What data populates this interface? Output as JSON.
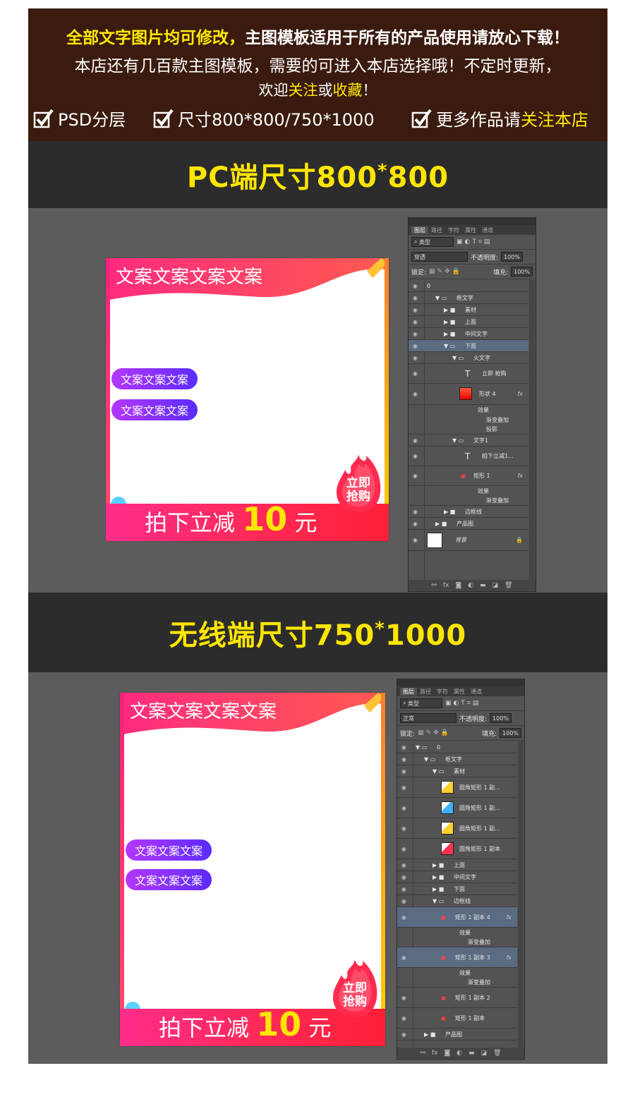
{
  "header": {
    "line1_bold": "全部文字图片均可修改，",
    "line1_rest": "主图模板适用于所有的产品使用请放心下载！",
    "line2": "本店还有几百款主图模板，需要的可进入本店选择哦！不定时更新，",
    "line3_a": "欢迎",
    "line3_b": "关注",
    "line3_c": "或",
    "line3_d": "收藏",
    "line3_e": "！",
    "check1": "PSD分层",
    "check2": "尺寸800*800/750*1000",
    "check3_a": "更多作品请",
    "check3_b": "关注本店"
  },
  "pc": {
    "banner_a": "PC端尺寸800",
    "banner_star": "*",
    "banner_b": "800",
    "template": {
      "title": "文案文案文案文案",
      "pill1": "文案文案文案",
      "pill2": "文案文案文案",
      "badge_l1": "立即",
      "badge_l2": "抢购",
      "bottom_pre": "拍下立减 ",
      "bottom_num": "10",
      "bottom_post": " 元"
    },
    "panel": {
      "tabs": [
        "图层",
        "路径",
        "字符",
        "属性",
        "通道"
      ],
      "filter": "类型",
      "blend": "穿透",
      "opacity_label": "不透明度:",
      "opacity": "100%",
      "lock_label": "锁定:",
      "fill_label": "填充:",
      "fill": "100%",
      "layers": [
        "0",
        "框文字",
        "素材",
        "上面",
        "中间文字",
        "下面",
        "火文字",
        "立即 抢购",
        "形状 4",
        "效果",
        "渐变叠加",
        "投影",
        "文字1",
        "拍下立减1...",
        "矩形 1",
        "效果",
        "渐变叠加",
        "边框线",
        "产品图",
        "背景"
      ]
    }
  },
  "mobile": {
    "banner_a": "无线端尺寸750",
    "banner_star": "*",
    "banner_b": "1000",
    "template": {
      "title": "文案文案文案文案",
      "pill1": "文案文案文案",
      "pill2": "文案文案文案",
      "badge_l1": "立即",
      "badge_l2": "抢购",
      "bottom_pre": "拍下立减 ",
      "bottom_num": "10",
      "bottom_post": " 元"
    },
    "panel": {
      "tabs": [
        "图层",
        "路径",
        "字符",
        "属性",
        "通道"
      ],
      "filter": "类型",
      "blend": "正常",
      "opacity_label": "不透明度:",
      "opacity": "100%",
      "lock_label": "锁定:",
      "fill_label": "填充:",
      "fill": "100%",
      "layers": [
        "0",
        "框文字",
        "素材",
        "圆角矩形 1 副...",
        "圆角矩形 1 副...",
        "圆角矩形 1 副...",
        "圆角矩形 1 副本",
        "上面",
        "中间文字",
        "下面",
        "边框线",
        "矩形 1 副本 4",
        "效果",
        "渐变叠加",
        "矩形 1 副本 3",
        "效果",
        "渐变叠加",
        "矩形 1 副本 2",
        "矩形 1 副本",
        "产品图"
      ]
    }
  },
  "colors": {
    "accent": "#ffea00",
    "header_bg": "#3b1b0f",
    "banner_bg": "#2c2c2c",
    "canvas_bg": "#5c5c5c",
    "pill": "#8a30ff",
    "promo": "#ff2a5a"
  }
}
